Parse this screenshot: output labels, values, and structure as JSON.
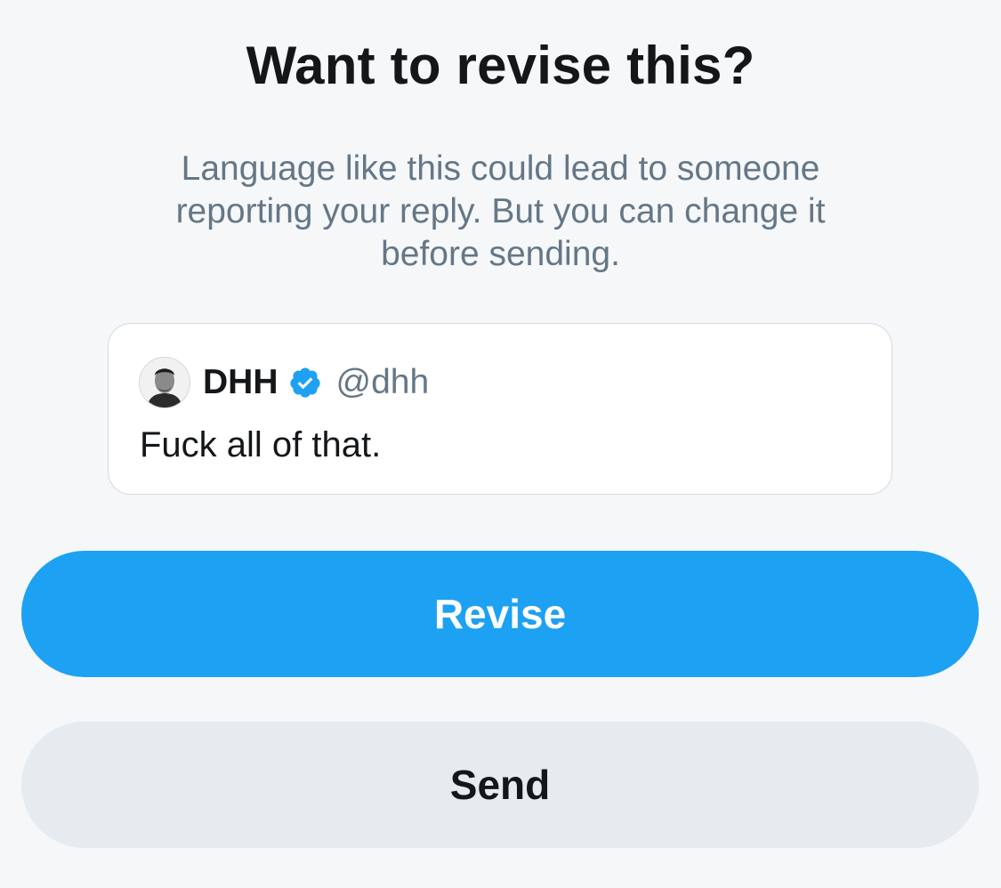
{
  "dialog": {
    "title": "Want to revise this?",
    "message": "Language like this could lead to someone reporting your reply. But you can change it before sending."
  },
  "reply": {
    "author": {
      "display_name": "DHH",
      "verified": true,
      "handle": "@dhh",
      "avatar_icon": "profile-photo"
    },
    "text": "Fuck all of that."
  },
  "actions": {
    "revise_label": "Revise",
    "send_label": "Send"
  },
  "colors": {
    "accent": "#1da1f2",
    "secondary_button": "#e6ebf0",
    "text_primary": "#14171a",
    "text_secondary": "#657786",
    "background": "#f5f7f9"
  }
}
